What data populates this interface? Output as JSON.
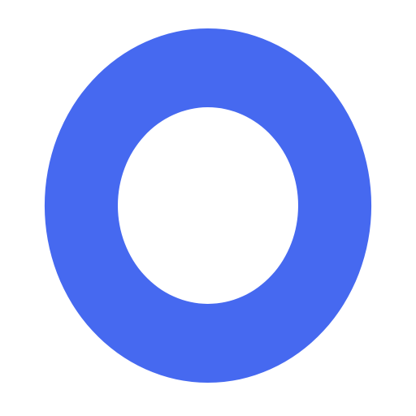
{
  "graphic": {
    "icon": "ring-icon",
    "ring_color": "#4669F0",
    "center_color": "#FFFFFF",
    "background_color": "#FFFFFF"
  }
}
